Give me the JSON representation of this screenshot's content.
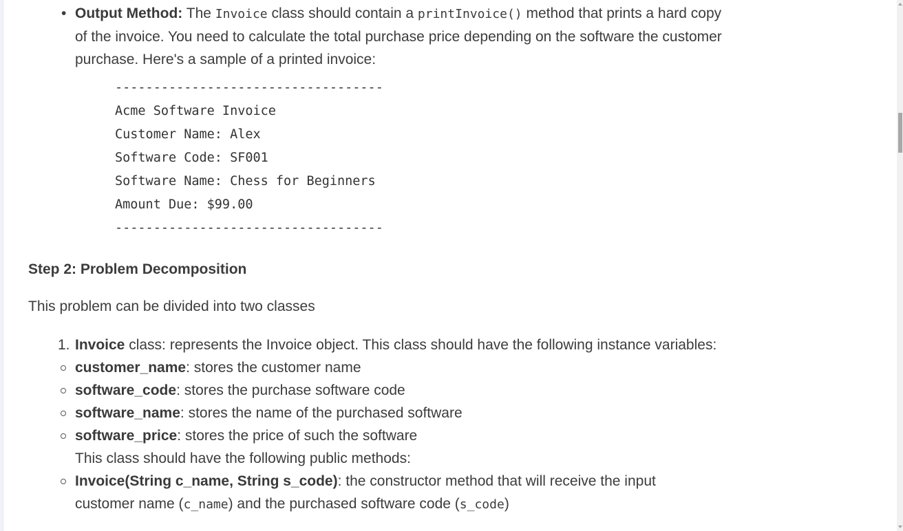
{
  "output_method": {
    "label": "Output Method:",
    "text_1": " The ",
    "code_1": "Invoice",
    "text_2": " class should contain a ",
    "code_2": "printInvoice()",
    "text_3": " method that prints a hard copy of the invoice. You need to calculate the total purchase price depending on the software the customer purchase. Here's a sample of a printed invoice:"
  },
  "invoice_sample": {
    "separator_top": "-----------------------------------",
    "lines": [
      "Acme Software Invoice",
      "Customer Name: Alex",
      "Software Code: SF001",
      "Software Name: Chess for Beginners",
      "Amount Due: $99.00"
    ],
    "separator_bottom": "-----------------------------------"
  },
  "step2": {
    "heading": "Step 2: Problem Decomposition",
    "intro": "This problem can be divided into two classes"
  },
  "classes": [
    {
      "marker": "1.",
      "name": "Invoice",
      "description": " class: represents the Invoice object. This class should have the following instance variables:",
      "instance_variables": [
        {
          "name": "customer_name",
          "description": ": stores the customer name"
        },
        {
          "name": "software_code",
          "description": ": stores the purchase software code"
        },
        {
          "name": "software_name",
          "description": ": stores the name of the purchased software"
        },
        {
          "name": "software_price",
          "description": ": stores the price of such the software"
        }
      ],
      "methods_intro": "This class should have the following public methods:",
      "methods": [
        {
          "signature": "Invoice(String c_name, String s_code)",
          "text_1": ": the constructor method that will receive the input customer name (",
          "code_1": "c_name",
          "text_2": ") and the purchased software code (",
          "code_2": "s_code",
          "text_3": ")"
        }
      ]
    }
  ],
  "scrollbar": {
    "position_fraction": 0.2
  }
}
